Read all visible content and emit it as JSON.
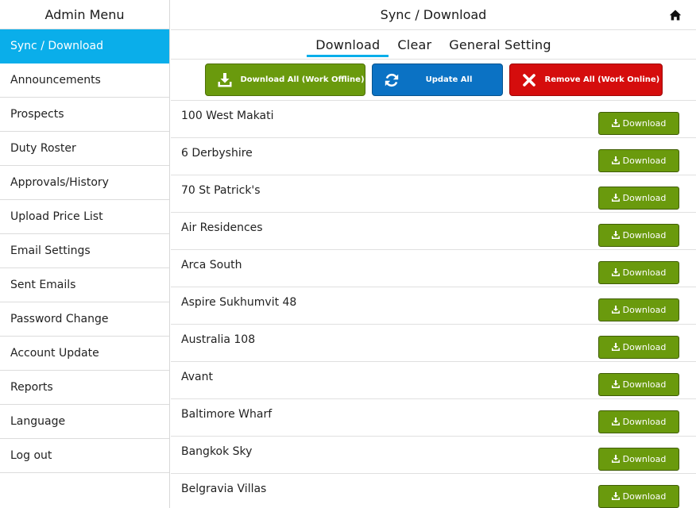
{
  "sidebar": {
    "title": "Admin Menu",
    "items": [
      {
        "label": "Sync / Download",
        "active": true
      },
      {
        "label": "Announcements"
      },
      {
        "label": "Prospects"
      },
      {
        "label": "Duty Roster"
      },
      {
        "label": "Approvals/History"
      },
      {
        "label": "Upload Price List"
      },
      {
        "label": "Email Settings"
      },
      {
        "label": "Sent Emails"
      },
      {
        "label": "Password Change"
      },
      {
        "label": "Account Update"
      },
      {
        "label": "Reports"
      },
      {
        "label": "Language"
      },
      {
        "label": "Log out"
      }
    ]
  },
  "header": {
    "title": "Sync / Download",
    "home_icon": "home-icon"
  },
  "tabs": [
    {
      "label": "Download",
      "active": true
    },
    {
      "label": "Clear"
    },
    {
      "label": "General Setting"
    }
  ],
  "actions": {
    "download_all": "Download All (Work Offline)",
    "update_all": "Update All",
    "remove_all": "Remove All (Work Online)"
  },
  "colors": {
    "accent": "#0aaeea",
    "green": "#6a9a0d",
    "blue": "#0b72c4",
    "red": "#d50d0d"
  },
  "projects": [
    {
      "name": "100 West Makati",
      "button": "Download"
    },
    {
      "name": "6 Derbyshire",
      "button": "Download"
    },
    {
      "name": "70 St Patrick's",
      "button": "Download"
    },
    {
      "name": "Air Residences",
      "button": "Download"
    },
    {
      "name": "Arca South",
      "button": "Download"
    },
    {
      "name": "Aspire Sukhumvit 48",
      "button": "Download"
    },
    {
      "name": "Australia 108",
      "button": "Download"
    },
    {
      "name": "Avant",
      "button": "Download"
    },
    {
      "name": "Baltimore Wharf",
      "button": "Download"
    },
    {
      "name": "Bangkok Sky",
      "button": "Download"
    },
    {
      "name": "Belgravia Villas",
      "button": "Download"
    }
  ]
}
